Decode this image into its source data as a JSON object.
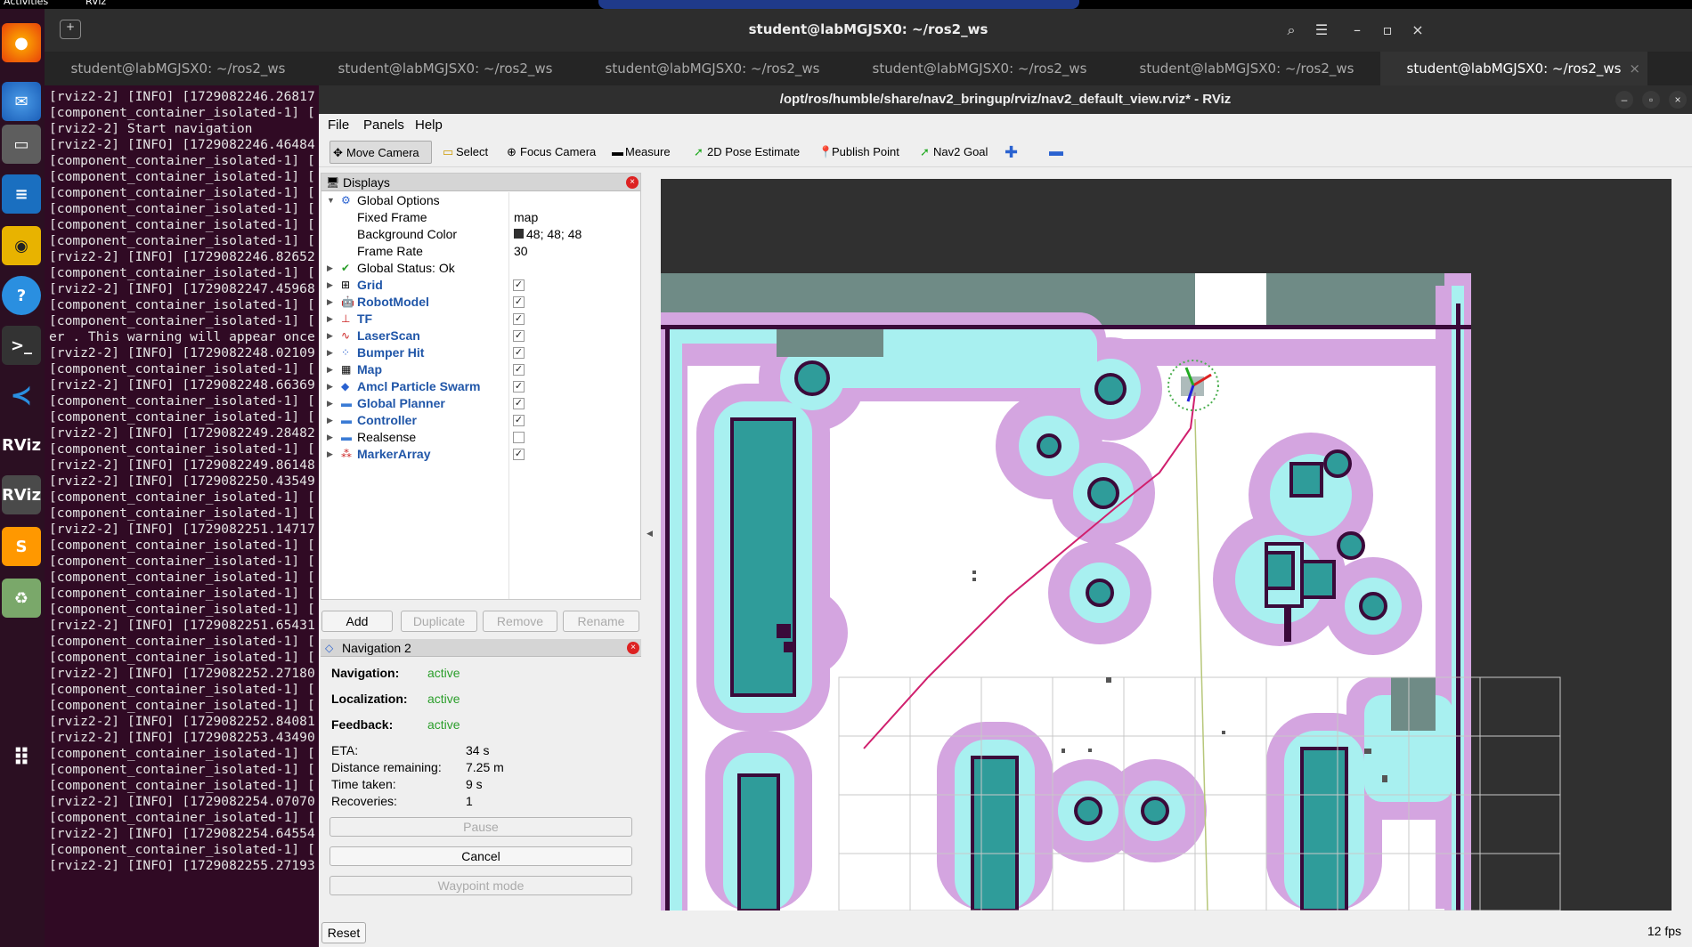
{
  "topbar": {
    "activities": "Activities",
    "app": "RViz"
  },
  "dock": {
    "items": [
      "firefox-icon",
      "thunderbird-icon",
      "files-icon",
      "writer-icon",
      "rhythmbox-icon",
      "help-icon",
      "terminal-icon",
      "vscode-icon",
      "rviz-icon",
      "rviz-icon",
      "sublime-icon",
      "trash-icon",
      "apps-grid-icon"
    ]
  },
  "terminal": {
    "window_title": "student@labMGJSX0: ~/ros2_ws",
    "tabs": [
      "student@labMGJSX0: ~/ros2_ws",
      "student@labMGJSX0: ~/ros2_ws",
      "student@labMGJSX0: ~/ros2_ws",
      "student@labMGJSX0: ~/ros2_ws",
      "student@labMGJSX0: ~/ros2_ws",
      "student@labMGJSX0: ~/ros2_ws"
    ],
    "lines": "[rviz2-2] [INFO] [1729082246.26817\n[component_container_isolated-1] [\n[rviz2-2] Start navigation\n[rviz2-2] [INFO] [1729082246.46484\n[component_container_isolated-1] [\n[component_container_isolated-1] [\n[component_container_isolated-1] [\n[component_container_isolated-1] [\n[component_container_isolated-1] [\n[component_container_isolated-1] [\n[rviz2-2] [INFO] [1729082246.82652\n[component_container_isolated-1] [\n[rviz2-2] [INFO] [1729082247.45968\n[component_container_isolated-1] [\n[component_container_isolated-1] [\ner . This warning will appear once\n[rviz2-2] [INFO] [1729082248.02109\n[component_container_isolated-1] [\n[rviz2-2] [INFO] [1729082248.66369\n[component_container_isolated-1] [\n[component_container_isolated-1] [\n[rviz2-2] [INFO] [1729082249.28482\n[component_container_isolated-1] [\n[rviz2-2] [INFO] [1729082249.86148\n[rviz2-2] [INFO] [1729082250.43549\n[component_container_isolated-1] [\n[component_container_isolated-1] [\n[rviz2-2] [INFO] [1729082251.14717\n[component_container_isolated-1] [\n[component_container_isolated-1] [\n[component_container_isolated-1] [\n[component_container_isolated-1] [\n[component_container_isolated-1] [\n[rviz2-2] [INFO] [1729082251.65431\n[component_container_isolated-1] [\n[component_container_isolated-1] [\n[rviz2-2] [INFO] [1729082252.27180\n[component_container_isolated-1] [\n[component_container_isolated-1] [\n[rviz2-2] [INFO] [1729082252.84081\n[rviz2-2] [INFO] [1729082253.43490\n[component_container_isolated-1] [\n[component_container_isolated-1] [\n[component_container_isolated-1] [\n[rviz2-2] [INFO] [1729082254.07070\n[component_container_isolated-1] [\n[rviz2-2] [INFO] [1729082254.64554\n[component_container_isolated-1] [\n[rviz2-2] [INFO] [1729082255.27193"
  },
  "rviz": {
    "title": "/opt/ros/humble/share/nav2_bringup/rviz/nav2_default_view.rviz* - RViz",
    "menu": [
      "File",
      "Panels",
      "Help"
    ],
    "tools": [
      "Move Camera",
      "Select",
      "Focus Camera",
      "Measure",
      "2D Pose Estimate",
      "Publish Point",
      "Nav2 Goal"
    ],
    "displays": {
      "header": "Displays",
      "global": {
        "label": "Global Options",
        "fixed_frame_label": "Fixed Frame",
        "fixed_frame": "map",
        "bg_label": "Background Color",
        "bg": "48; 48; 48",
        "fr_label": "Frame Rate",
        "fr": "30",
        "status": "Global Status: Ok"
      },
      "items": [
        "Grid",
        "RobotModel",
        "TF",
        "LaserScan",
        "Bumper Hit",
        "Map",
        "Amcl Particle Swarm",
        "Global Planner",
        "Controller",
        "Realsense",
        "MarkerArray"
      ],
      "buttons": [
        "Add",
        "Duplicate",
        "Remove",
        "Rename"
      ]
    },
    "nav2": {
      "header": "Navigation 2",
      "navigation_label": "Navigation:",
      "navigation": "active",
      "localization_label": "Localization:",
      "localization": "active",
      "feedback_label": "Feedback:",
      "feedback": "active",
      "eta_label": "ETA:",
      "eta": "34 s",
      "dist_label": "Distance remaining:",
      "dist": "7.25 m",
      "time_label": "Time taken:",
      "time": "9 s",
      "rec_label": "Recoveries:",
      "rec": "1",
      "pause": "Pause",
      "cancel": "Cancel",
      "waypoint": "Waypoint mode"
    },
    "reset": "Reset",
    "fps": "12 fps"
  }
}
